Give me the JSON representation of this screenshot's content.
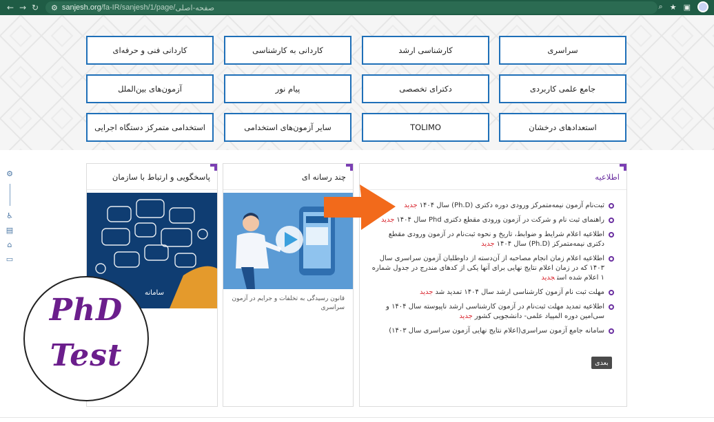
{
  "browser": {
    "url_host": "sanjesh.org",
    "url_path": "/fa-IR/sanjesh/1/page/",
    "url_page_title": "صفحه-اصلی",
    "back_icon": "arrow-left-icon",
    "forward_icon": "arrow-right-icon",
    "refresh_icon": "refresh-icon",
    "zoom_icon": "zoom-icon",
    "star_icon": "star-icon",
    "extensions_icon": "puzzle-icon"
  },
  "categories": [
    {
      "label": "سراسری"
    },
    {
      "label": "کارشناسی ارشد"
    },
    {
      "label": "کاردانی به کارشناسی"
    },
    {
      "label": "کاردانی فنی و حرفه‌ای"
    },
    {
      "label": "جامع علمی کاربردی"
    },
    {
      "label": "دکترای تخصصی"
    },
    {
      "label": "پیام نور"
    },
    {
      "label": "آزمون‌های بین‌الملل"
    },
    {
      "label": "استعدادهای درخشان"
    },
    {
      "label": "TOLIMO"
    },
    {
      "label": "سایر آزمون‌های استخدامی"
    },
    {
      "label": "استخدامی متمرکز دستگاه اجرایی"
    }
  ],
  "news": {
    "title": "اطلاعیه",
    "new_label": "جدید",
    "next_label": "بعدی",
    "items": [
      {
        "text": "ثبت‌نام آزمون نیمه‌متمرکز ورودی دوره دکتری (Ph.D) سال ۱۴۰۴",
        "is_new": true
      },
      {
        "text": "راهنمای ثبت نام و شرکت در آزمون ورودی مقطع دکتری Phd سال ۱۴۰۴",
        "is_new": true
      },
      {
        "text": "اطلاعیه اعلام شرایط و ضوابط، تاریخ و نحوه ثبت‌نام در آزمون ورودی مقطع دکتری نیمه‌متمرکز (Ph.D) سال ۱۴۰۴",
        "is_new": true
      },
      {
        "text": "اطلاعیه اعلام زمان انجام مصاحبه از آن‌دسته از داوطلبان آزمون سراسری سال ۱۴۰۳ که در زمان اعلام نتایج نهایی برای آنها یکی از کدهای مندرج در جدول شماره ۱ اعلام شده است",
        "is_new": true
      },
      {
        "text": "مهلت ثبت نام آزمون کارشناسی ارشد  سال ۱۴۰۴ تمدید شد",
        "is_new": true
      },
      {
        "text": "اطلاعیه تمدید مهلت ثبت‌نام در آزمون کارشناسی ارشد ناپیوسته سال ۱۴۰۴ و سی‌امین دوره المپیاد علمی- دانشجویی کشور",
        "is_new": true
      },
      {
        "text": "سامانه جامع آزمون سراسری(اعلام نتایج نهایی آزمون سراسری سال ۱۴۰۳)",
        "is_new": false
      }
    ]
  },
  "media": {
    "title": "چند رسانه ای",
    "caption": "قانون رسیدگی به تخلفات و جرایم در آزمون سراسری"
  },
  "support": {
    "title": "پاسخگویی و ارتباط با سازمان",
    "banner_text": "سامانه"
  },
  "badge": {
    "line1": "PhD",
    "line2": "Test"
  },
  "colors": {
    "browser_bar": "#1f5c45",
    "tile_border": "#1e6fb8",
    "accent_purple": "#6a2fa0",
    "new_red": "#d9262f",
    "arrow_orange": "#f26a1b"
  }
}
